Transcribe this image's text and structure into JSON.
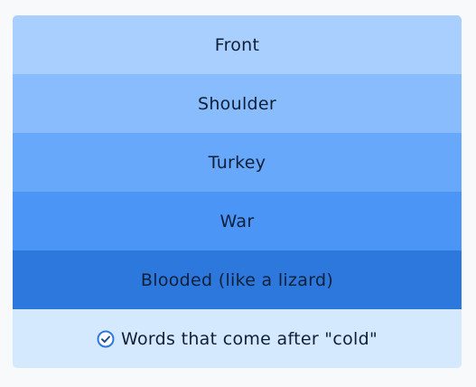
{
  "group": {
    "items": [
      {
        "label": "Front"
      },
      {
        "label": "Shoulder"
      },
      {
        "label": "Turkey"
      },
      {
        "label": "War"
      },
      {
        "label": "Blooded (like a lizard)"
      }
    ],
    "category": {
      "label": "Words that come after \"cold\"",
      "icon": "check-circle-icon"
    }
  },
  "colors": {
    "row_1": "#a9cffe",
    "row_2": "#88bcfd",
    "row_3": "#67a8fb",
    "row_4": "#4a95f6",
    "row_5": "#2c78dd",
    "footer": "#d4e8fe",
    "icon": "#2c78dd"
  }
}
